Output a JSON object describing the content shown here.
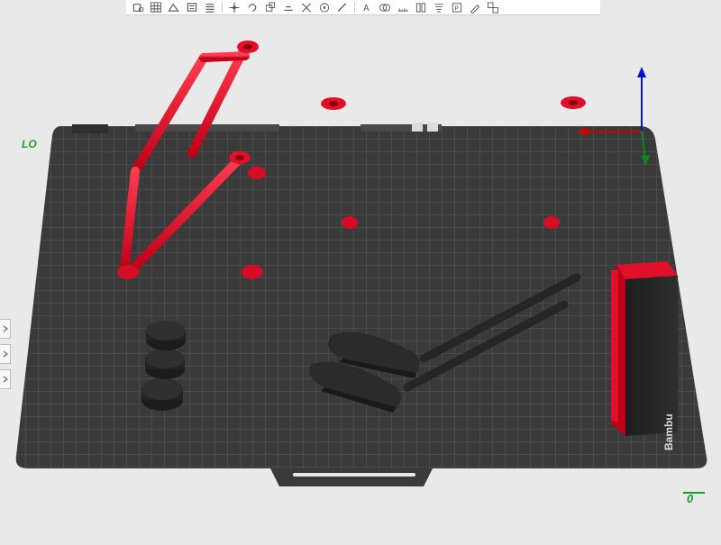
{
  "labels": {
    "bed_text": "Bambu",
    "zoom_left": "LO",
    "zoom_right": "0"
  },
  "toolbar": {
    "icons": [
      "add-part-icon",
      "grid-arrange-icon",
      "auto-orient-icon",
      "layers-icon",
      "list-icon",
      "move-icon",
      "rotate-icon",
      "scale-icon",
      "lay-flat-icon",
      "cut-icon",
      "support-paint-icon",
      "seam-paint-icon",
      "text-icon",
      "mesh-boolean-icon",
      "measure-icon",
      "split-icon",
      "variable-layer-icon",
      "emboss-icon",
      "color-paint-icon",
      "assembly-icon"
    ]
  },
  "side_buttons": [
    "expand-panel-arrow",
    "collapse-panel-arrow",
    "panel-arrow"
  ],
  "colors": {
    "background": "#e9e9e9",
    "bed": "#3a3a3a",
    "grid_line": "#5c5c5c",
    "model_red": "#e0102a",
    "model_black": "#2b2b2b",
    "axis_x": "#d40000",
    "axis_y": "#0c8a1a",
    "axis_z": "#0a12c8"
  }
}
